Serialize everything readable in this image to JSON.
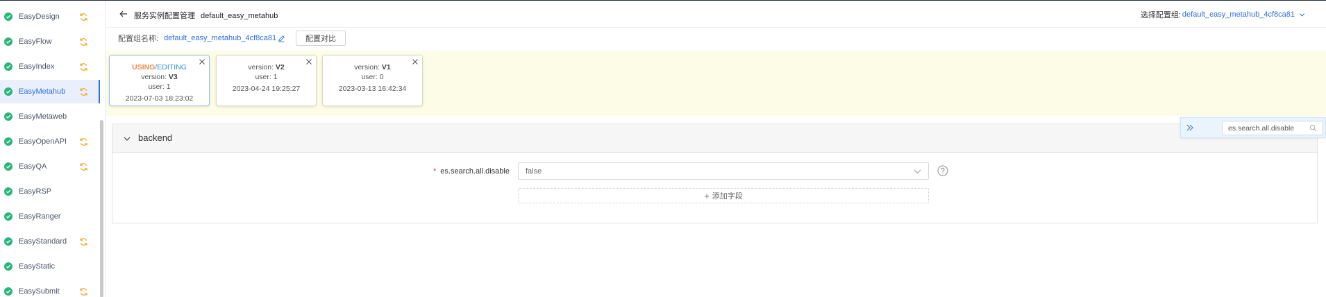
{
  "sidebar": {
    "items": [
      {
        "label": "EasyDesign",
        "sync": true,
        "active": false
      },
      {
        "label": "EasyFlow",
        "sync": true,
        "active": false
      },
      {
        "label": "EasyIndex",
        "sync": true,
        "active": false
      },
      {
        "label": "EasyMetahub",
        "sync": true,
        "active": true
      },
      {
        "label": "EasyMetaweb",
        "sync": false,
        "active": false
      },
      {
        "label": "EasyOpenAPI",
        "sync": true,
        "active": false
      },
      {
        "label": "EasyQA",
        "sync": true,
        "active": false
      },
      {
        "label": "EasyRSP",
        "sync": false,
        "active": false
      },
      {
        "label": "EasyRanger",
        "sync": false,
        "active": false
      },
      {
        "label": "EasyStandard",
        "sync": true,
        "active": false
      },
      {
        "label": "EasyStatic",
        "sync": false,
        "active": false
      },
      {
        "label": "EasySubmit",
        "sync": true,
        "active": false
      }
    ]
  },
  "header": {
    "title": "服务实例配置管理",
    "instance": "default_easy_metahub",
    "group_label": "选择配置组:",
    "group_value": "default_easy_metahub_4cf8ca81"
  },
  "config": {
    "name_label": "配置组名称:",
    "name_value": "default_easy_metahub_4cf8ca81",
    "compare_label": "配置对比"
  },
  "versions": [
    {
      "status_using": "USING",
      "status_sep": "/",
      "status_editing": "EDITING",
      "version_prefix": "version: ",
      "version": "V3",
      "user": "user: 1",
      "time": "2023-07-03 18:23:02"
    },
    {
      "version_prefix": "version: ",
      "version": "V2",
      "user": "user: 1",
      "time": "2023-04-24 19:25:27"
    },
    {
      "version_prefix": "version: ",
      "version": "V1",
      "user": "user: 0",
      "time": "2023-03-13 16:42:34"
    }
  ],
  "section": {
    "title": "backend",
    "field": {
      "label": "es.search.all.disable",
      "value": "false"
    },
    "add_label": "添加字段"
  },
  "search": {
    "value": "es.search.all.disable"
  },
  "colors": {
    "accent": "#2f6fde",
    "success": "#2ab57d",
    "sync": "#f5a623",
    "using": "#f08a4b",
    "editing": "#2f8fd6",
    "band": "#fdfce6"
  }
}
